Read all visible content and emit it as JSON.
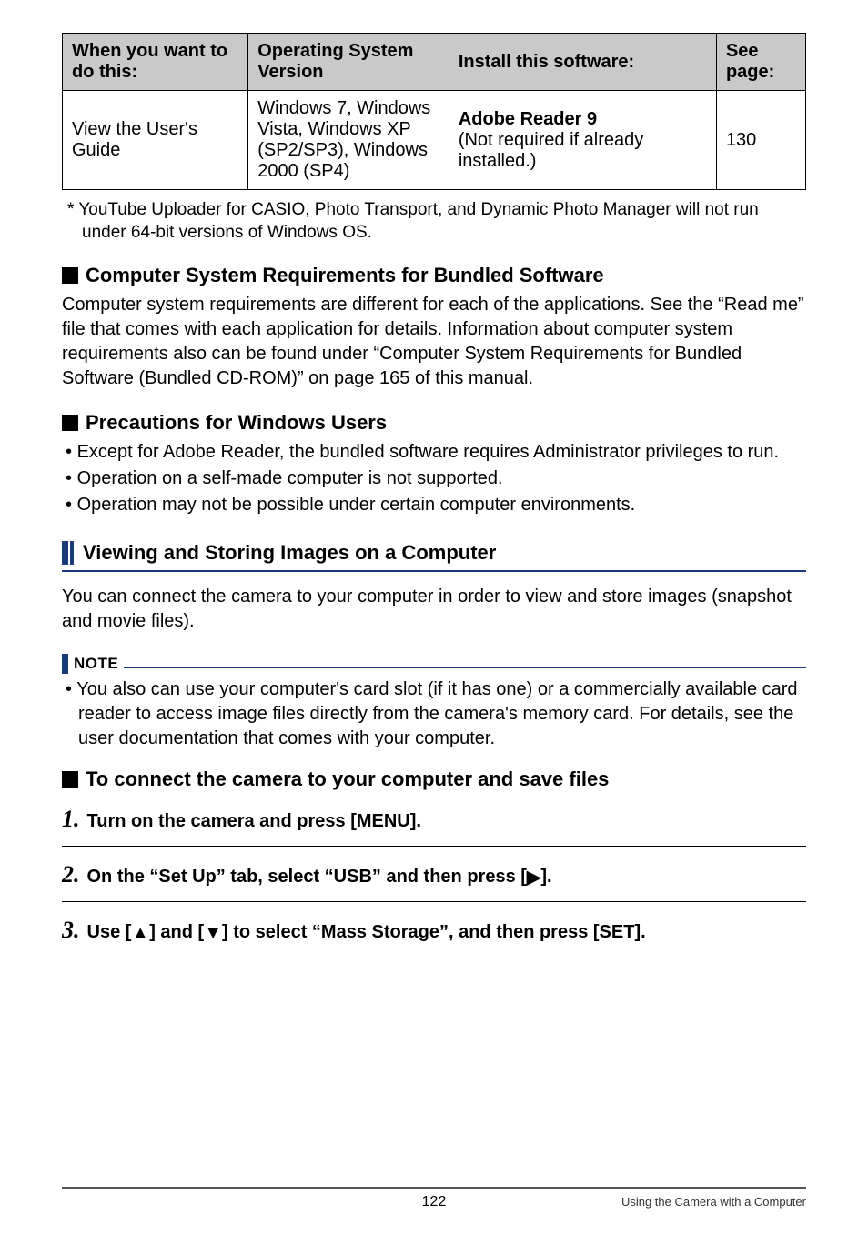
{
  "table": {
    "headers": {
      "col1": "When you want to do this:",
      "col2": "Operating System Version",
      "col3": "Install this software:",
      "col4": "See page:"
    },
    "row": {
      "task": "View the User's Guide",
      "os": "Windows 7, Windows Vista, Windows XP (SP2/SP3), Windows 2000 (SP4)",
      "software_name": "Adobe Reader 9",
      "software_note": "(Not required if already installed.)",
      "page": "130"
    }
  },
  "footnote": "YouTube Uploader for CASIO, Photo Transport, and Dynamic Photo Manager will not run under 64-bit versions of Windows OS.",
  "heading1": "Computer System Requirements for Bundled Software",
  "body1": "Computer system requirements are different for each of the applications. See the “Read me” file that comes with each application for details. Information about computer system requirements also can be found under “Computer System Requirements for Bundled Software (Bundled CD-ROM)” on page 165 of this manual.",
  "heading2": "Precautions for Windows Users",
  "bullets2": [
    "Except for Adobe Reader, the bundled software requires Administrator privileges to run.",
    "Operation on a self-made computer is not supported.",
    "Operation may not be possible under certain computer environments."
  ],
  "section_title": "Viewing and Storing Images on a Computer",
  "body3": "You can connect the camera to your computer in order to view and store images (snapshot and movie files).",
  "note_label": "NOTE",
  "note_bullet": "You also can use your computer's card slot (if it has one) or a commercially available card reader to access image files directly from the camera's memory card. For details, see the user documentation that comes with your computer.",
  "heading3": "To connect the camera to your computer and save files",
  "steps": {
    "s1": {
      "num": "1.",
      "text": "Turn on the camera and press [MENU]."
    },
    "s2": {
      "num": "2.",
      "text_pre": "On the “Set Up” tab, select “USB” and then press [",
      "text_post": "]."
    },
    "s3": {
      "num": "3.",
      "text_pre": "Use [",
      "text_mid": "] and [",
      "text_post": "] to select “Mass Storage”, and then press [SET]."
    }
  },
  "footer": {
    "page_number": "122",
    "right_text": "Using the Camera with a Computer"
  }
}
